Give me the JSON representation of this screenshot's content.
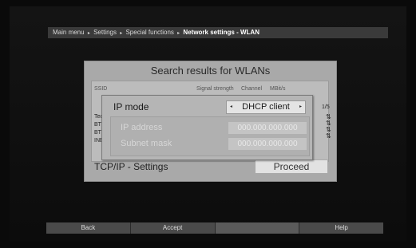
{
  "breadcrumb": {
    "items": [
      "Main menu",
      "Settings",
      "Special functions"
    ],
    "current": "Network settings - WLAN",
    "separator": "▸"
  },
  "search_dialog": {
    "title": "Search results for WLANs",
    "headers": {
      "ssid": "SSID",
      "signal": "Signal strength",
      "channel": "Channel",
      "mbit": "MBit/s"
    },
    "rows": [
      "Tec",
      "BT",
      "BTE",
      "INE"
    ],
    "page_indicator": "1/5",
    "tcpip_label": "TCP/IP - Settings",
    "proceed_label": "Proceed"
  },
  "ip_dialog": {
    "ip_mode_label": "IP mode",
    "ip_mode_value": "DHCP client",
    "ip_address_label": "IP address",
    "ip_address_value": "000.000.000.000",
    "subnet_mask_label": "Subnet mask",
    "subnet_mask_value": "000.000.000.000"
  },
  "bottom_bar": {
    "back": "Back",
    "accept": "Accept",
    "blank": "",
    "help": "Help"
  },
  "icons": {
    "left_arrow": "◂",
    "right_arrow": "▸",
    "signal": "⇅"
  }
}
